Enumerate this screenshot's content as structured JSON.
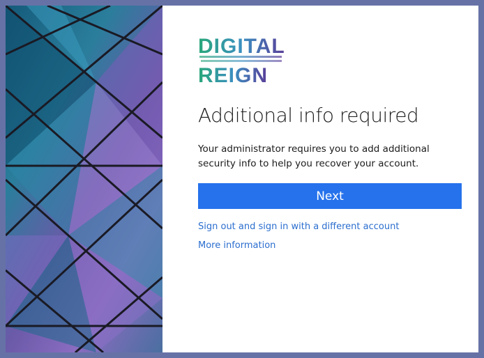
{
  "logo": {
    "line1": "DIGITAL",
    "line2": "REIGN"
  },
  "title": "Additional info required",
  "description": "Your administrator requires you to add additional security info to help you recover your account.",
  "next_label": "Next",
  "links": [
    "Sign out and sign in with a different account",
    "More information"
  ],
  "colors": {
    "border": "#6672a6",
    "button": "#2672ec",
    "link": "#2b6ecf"
  }
}
